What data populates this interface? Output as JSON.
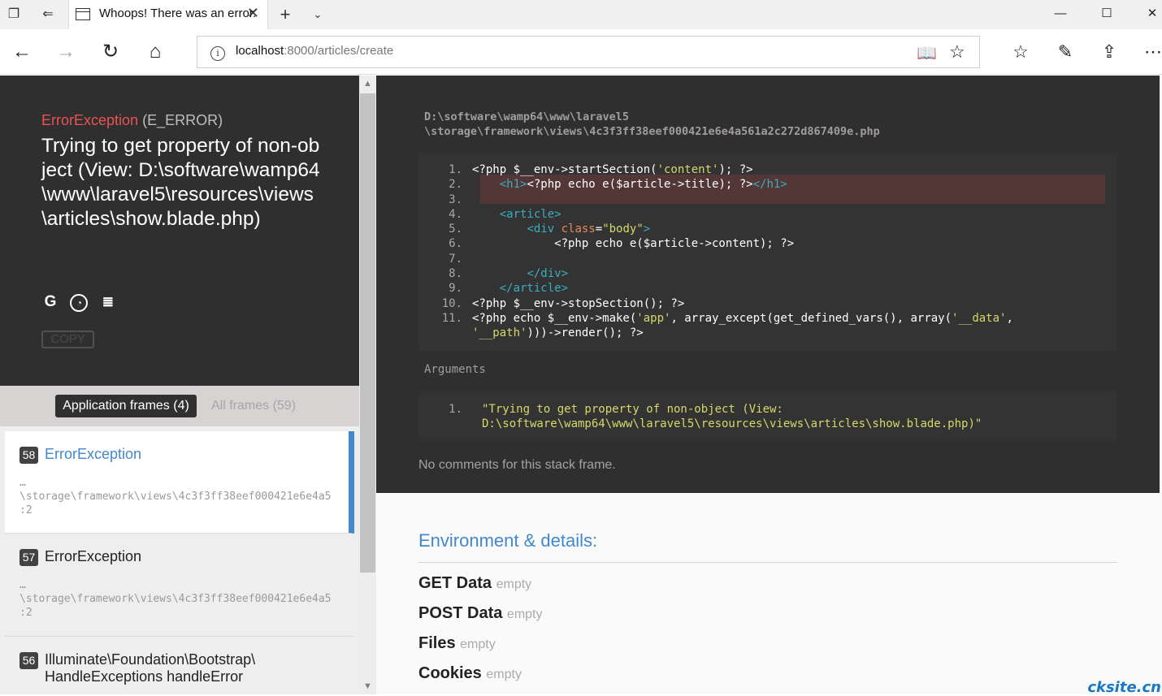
{
  "browser": {
    "tab_title": "Whoops! There was an error.",
    "url_host": "localhost",
    "url_path": ":8000/articles/create",
    "window_controls": {
      "minimize": "—",
      "maximize": "☐",
      "close": "✕"
    }
  },
  "exception": {
    "class": "ErrorException",
    "code": "(E_ERROR)",
    "message": "Trying to get property of non-object (View: D:\\software\\wamp64\\www\\laravel5\\resources\\views\\articles\\show.blade.php)",
    "search_icons": [
      "google-icon",
      "duckduckgo-icon",
      "stackoverflow-icon"
    ],
    "copy_label": "COPY"
  },
  "frames_tabs": {
    "application": "Application frames (4)",
    "all": "All frames (59)"
  },
  "frames": [
    {
      "index": "58",
      "class": "ErrorException",
      "path": "…\n\\storage\\framework\\views\\4c3f3ff38eef000421e6e4a5\n:2"
    },
    {
      "index": "57",
      "class": "ErrorException",
      "path": "…\n\\storage\\framework\\views\\4c3f3ff38eef000421e6e4a5\n:2"
    },
    {
      "index": "56",
      "class": "Illuminate\\Foundation\\Bootstrap\\\nHandleExceptions handleError",
      "path": ""
    }
  ],
  "file": {
    "line1": "D:\\software\\wamp64\\www\\laravel5",
    "line2": "\\storage\\framework\\views\\4c3f3ff38eef000421e6e4a561a2c272d867409e.php"
  },
  "code_lines": [
    {
      "n": "1."
    },
    {
      "n": "2."
    },
    {
      "n": "3."
    },
    {
      "n": "4."
    },
    {
      "n": "5."
    },
    {
      "n": "6."
    },
    {
      "n": "7."
    },
    {
      "n": "8."
    },
    {
      "n": "9."
    },
    {
      "n": "10."
    },
    {
      "n": "11."
    }
  ],
  "arguments": {
    "label": "Arguments",
    "n": "1.",
    "value": "\"Trying to get property of non-object (View: D:\\software\\wamp64\\www\\laravel5\\resources\\views\\articles\\show.blade.php)\""
  },
  "no_comments": "No comments for this stack frame.",
  "environment": {
    "title": "Environment & details:",
    "rows": [
      {
        "label": "GET Data",
        "status": "empty"
      },
      {
        "label": "POST Data",
        "status": "empty"
      },
      {
        "label": "Files",
        "status": "empty"
      },
      {
        "label": "Cookies",
        "status": "empty"
      }
    ]
  },
  "watermark": "cksite.cn",
  "colors": {
    "accent": "#4288ce",
    "exception_class": "#e95353",
    "dark_panel": "#2f2f2f",
    "highlight_line": "#533737"
  }
}
